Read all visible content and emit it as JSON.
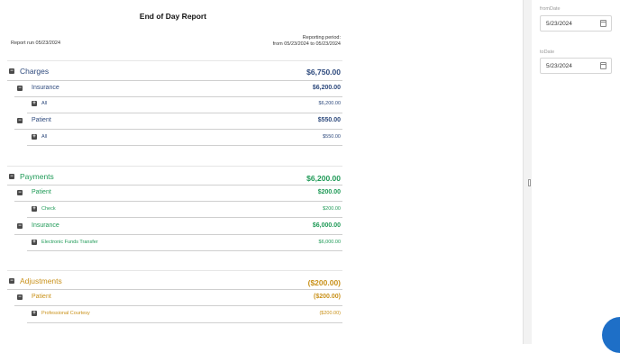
{
  "report": {
    "title": "End of Day Report",
    "run_line": "Report run 05/23/2024",
    "period_label": "Reporting period:",
    "period_range": "from 05/23/2024 to 05/23/2024"
  },
  "sections": {
    "charges": {
      "label": "Charges",
      "amount": "$6,750.00",
      "insurance": {
        "label": "Insurance",
        "amount": "$6,200.00",
        "sub_label": "All",
        "sub_amount": "$6,200.00"
      },
      "patient": {
        "label": "Patient",
        "amount": "$550.00",
        "sub_label": "All",
        "sub_amount": "$550.00"
      }
    },
    "payments": {
      "label": "Payments",
      "amount": "$6,200.00",
      "patient": {
        "label": "Patient",
        "amount": "$200.00",
        "sub_label": "Check",
        "sub_amount": "$200.00"
      },
      "insurance": {
        "label": "Insurance",
        "amount": "$6,000.00",
        "sub_label": "Electronic Funds Transfer",
        "sub_amount": "$6,000.00"
      }
    },
    "adjustments": {
      "label": "Adjustments",
      "amount": "($200.00)",
      "patient": {
        "label": "Patient",
        "amount": "($200.00)",
        "sub_label": "Professional Courtesy",
        "sub_amount": "($200.00)"
      }
    }
  },
  "icons": {
    "minus": "−",
    "plus": "+"
  },
  "filters": {
    "from_label": "fromDate",
    "from_value": "5/23/2024",
    "to_label": "toDate",
    "to_value": "5/23/2024"
  },
  "colors": {
    "charges": "#2e4a7d",
    "payments": "#1f9a57",
    "adjustments": "#c9911a",
    "fab": "#1e6fc7"
  }
}
